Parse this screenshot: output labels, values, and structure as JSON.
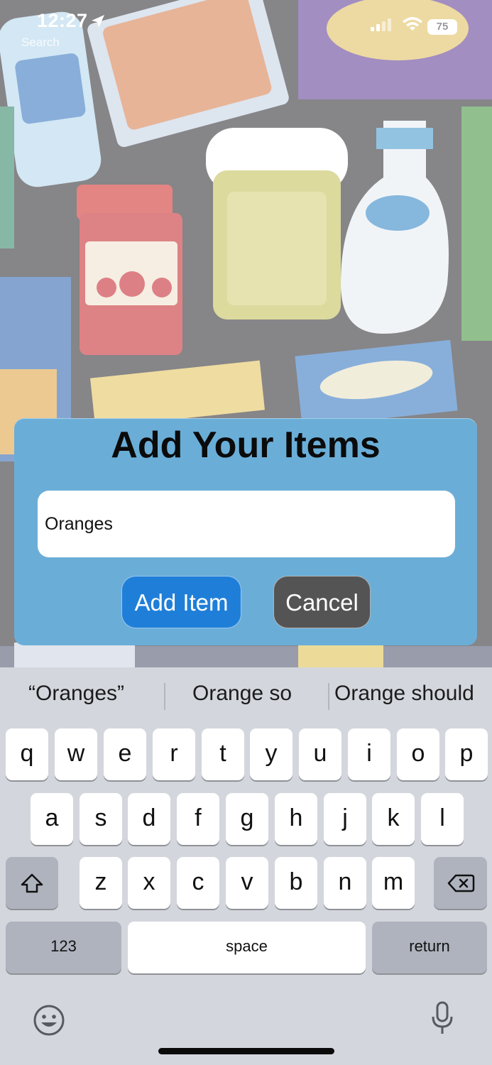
{
  "status_bar": {
    "time": "12:27",
    "back_app": "Search",
    "battery": "75"
  },
  "dialog": {
    "title": "Add Your Items",
    "input_value": "Oranges",
    "add_button": "Add Item",
    "cancel_button": "Cancel"
  },
  "keyboard": {
    "suggestions": [
      "“Oranges”",
      "Orange so",
      "Orange should"
    ],
    "row1": [
      "q",
      "w",
      "e",
      "r",
      "t",
      "y",
      "u",
      "i",
      "o",
      "p"
    ],
    "row2": [
      "a",
      "s",
      "d",
      "f",
      "g",
      "h",
      "j",
      "k",
      "l"
    ],
    "row3": [
      "z",
      "x",
      "c",
      "v",
      "b",
      "n",
      "m"
    ],
    "numbers_key": "123",
    "space_key": "space",
    "return_key": "return"
  },
  "colors": {
    "dialog_bg": "#6aaed8",
    "add_button_bg": "#1f7fd8",
    "cancel_button_bg": "#545454",
    "keyboard_bg": "#d3d6dc"
  },
  "icons": [
    "location-arrow-icon",
    "signal-icon",
    "wifi-icon",
    "battery-icon",
    "shift-icon",
    "backspace-icon",
    "emoji-icon",
    "microphone-icon"
  ]
}
